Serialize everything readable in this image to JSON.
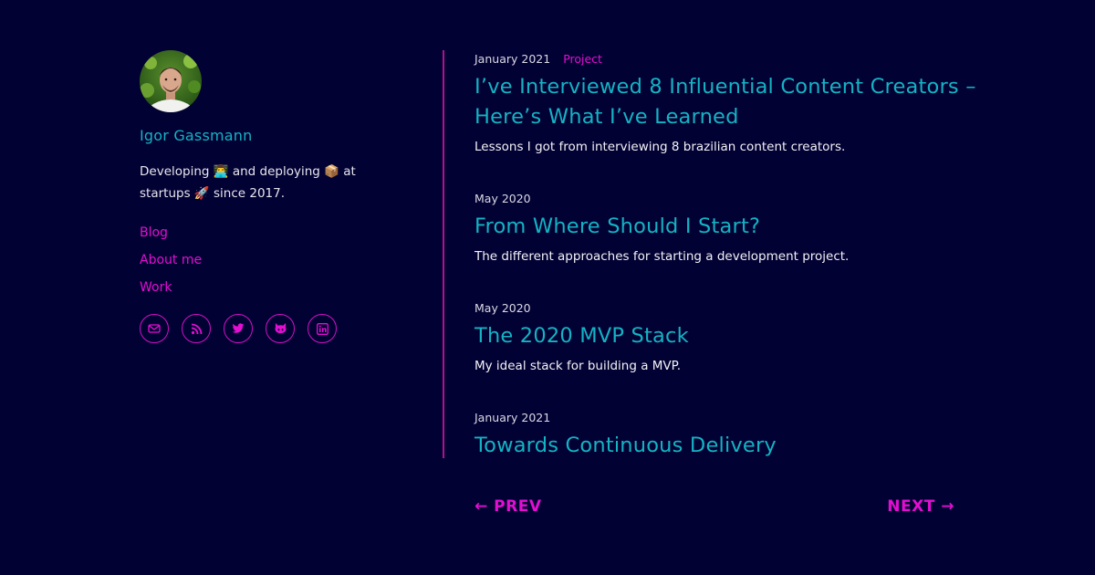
{
  "author": {
    "name": "Igor Gassmann",
    "bio_part1": "Developing ",
    "bio_part2": " and deploying ",
    "bio_part3": " at startups ",
    "bio_part4": " since 2017.",
    "emoji1": "👨‍💻",
    "emoji2": "📦",
    "emoji3": "🚀"
  },
  "nav": {
    "items": [
      {
        "label": "Blog"
      },
      {
        "label": "About me"
      },
      {
        "label": "Work"
      }
    ]
  },
  "socials": [
    {
      "icon": "mail-icon"
    },
    {
      "icon": "rss-icon"
    },
    {
      "icon": "twitter-icon"
    },
    {
      "icon": "github-icon"
    },
    {
      "icon": "linkedin-icon"
    }
  ],
  "posts": [
    {
      "date": "January 2021",
      "tag": "Project",
      "title": "I’ve Interviewed 8 Influential Content Creators – Here’s What I’ve Learned",
      "description": "Lessons I got from interviewing 8 brazilian content creators."
    },
    {
      "date": "May 2020",
      "tag": "",
      "title": "From Where Should I Start?",
      "description": "The different approaches for starting a development project."
    },
    {
      "date": "May 2020",
      "tag": "",
      "title": "The 2020 MVP Stack",
      "description": "My ideal stack for building a MVP."
    },
    {
      "date": "January 2021",
      "tag": "",
      "title": "Towards Continuous Delivery",
      "description": ""
    }
  ],
  "pager": {
    "prev": "← PREV",
    "next": "NEXT →"
  },
  "colors": {
    "background": "#020133",
    "accent_cyan": "#14b3c4",
    "accent_magenta": "#e20ed2"
  }
}
